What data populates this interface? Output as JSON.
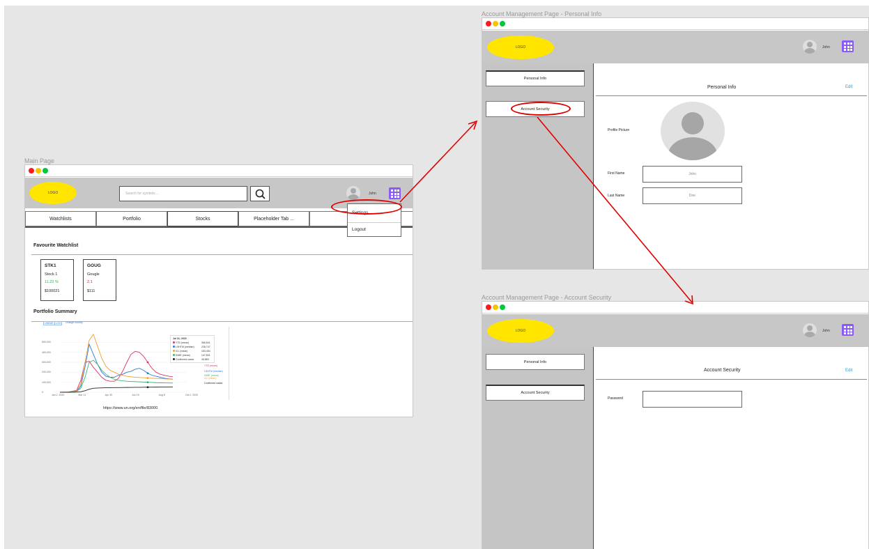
{
  "main_page": {
    "frame_label": "Main Page",
    "logo": "LOGO",
    "search_placeholder": "Search for symbols ...",
    "username": "John",
    "tabs": [
      "Watchlists",
      "Portfolio",
      "Stocks",
      "Placeholder Tab ..."
    ],
    "menu": {
      "settings": "Settings",
      "logout": "Logout"
    },
    "watchlist_title": "Favourite Watchlist",
    "cards": [
      {
        "symbol": "STK1",
        "name": "Stock 1",
        "change": "11.23 %",
        "change_color": "#2bb24c",
        "price": "$100021"
      },
      {
        "symbol": "GOUG",
        "name": "Gougle",
        "change": "2.1",
        "change_color": "#e02020",
        "price": "$111"
      }
    ],
    "portfolio_title": "Portfolio Summary",
    "chart_caption": "https://www.un.org/en/file/83000"
  },
  "personal_page": {
    "frame_label": "Account Management Page - Personal Info",
    "logo": "LOGO",
    "username": "John",
    "sidebar": [
      "Personal Info",
      "Account Security"
    ],
    "panel_title": "Personal Info",
    "edit": "Edit",
    "profile_label": "Profile Picture",
    "first_name_label": "First Name",
    "first_name_value": "John",
    "last_name_label": "Last Name",
    "last_name_value": "Doe"
  },
  "security_page": {
    "frame_label": "Account Management Page - Account Security",
    "logo": "LOGO",
    "username": "John",
    "sidebar": [
      "Personal Info",
      "Account Security"
    ],
    "panel_title": "Account Security",
    "edit": "Edit",
    "password_label": "Password"
  },
  "colors": {
    "logo": "#ffe500",
    "grid_icon": "#8a5cf5",
    "annotation": "#e00000",
    "edit_link": "#1aa0e8"
  },
  "chart_data": {
    "type": "line",
    "x_ticks": [
      "Jan 2, 2020",
      "Mar 11",
      "Apr 30",
      "Jun 19",
      "Aug 8",
      "Oct 2, 2020"
    ],
    "y_ticks": [
      "0",
      "100,000",
      "200,000",
      "300,000",
      "400,000",
      "500,000"
    ],
    "ylim": [
      0,
      600000
    ],
    "x": [
      0,
      20,
      40,
      50,
      60,
      70,
      80,
      90,
      100,
      110,
      120,
      130,
      140,
      150,
      160,
      170,
      180,
      190,
      200,
      210,
      220,
      230,
      240,
      250,
      260,
      270
    ],
    "series": [
      {
        "name": "YTD (mean)",
        "color": "#e0306a",
        "values": [
          0,
          2000,
          20000,
          120000,
          300000,
          310000,
          250000,
          200000,
          150000,
          120000,
          110000,
          110000,
          140000,
          210000,
          300000,
          380000,
          410000,
          400000,
          360000,
          300000,
          240000,
          200000,
          180000,
          170000,
          160000,
          155000
        ]
      },
      {
        "name": "LSHTM (median)",
        "color": "#2a7bd6",
        "values": [
          0,
          1000,
          10000,
          60000,
          250000,
          480000,
          380000,
          280000,
          200000,
          160000,
          150000,
          150000,
          170000,
          180000,
          200000,
          210000,
          230000,
          240000,
          220000,
          190000,
          170000,
          160000,
          150000,
          140000,
          135000,
          130000
        ]
      },
      {
        "name": "ICL (mean)",
        "color": "#f0a030",
        "values": [
          0,
          1000,
          15000,
          80000,
          300000,
          520000,
          580000,
          460000,
          340000,
          260000,
          220000,
          200000,
          180000,
          170000,
          160000,
          155000,
          150000,
          148000,
          145000,
          142000,
          140000,
          138000,
          136000,
          134000,
          132000,
          130000
        ]
      },
      {
        "name": "IHME (mean)",
        "color": "#3cb371",
        "values": [
          0,
          500,
          8000,
          40000,
          150000,
          300000,
          320000,
          280000,
          220000,
          180000,
          150000,
          130000,
          120000,
          115000,
          110000,
          108000,
          106000,
          104000,
          102000,
          100000,
          98000,
          96000,
          95000,
          94000,
          93000,
          92000
        ]
      },
      {
        "name": "Confirmed cases",
        "color": "#222222",
        "values": [
          0,
          0,
          1000,
          5000,
          15000,
          30000,
          40000,
          42000,
          44000,
          45000,
          46000,
          46500,
          47000,
          47500,
          48000,
          48500,
          49000,
          49500,
          50000,
          50500,
          51000,
          51500,
          52000,
          52500,
          53000,
          53500
        ]
      }
    ],
    "legend": {
      "date": "Jul 31, 2020",
      "rows": [
        {
          "label": "YTD (mean)",
          "value": "366,841"
        },
        {
          "label": "LSHTM (median)",
          "value": "228,747"
        },
        {
          "label": "ICL (mean)",
          "value": "163,454"
        },
        {
          "label": "IHME (mean)",
          "value": "147,801"
        },
        {
          "label": "Confirmed cases",
          "value": "45,863"
        }
      ]
    },
    "end_labels": [
      "YTD (mean)",
      "LSHTM (median)",
      "IHME (mean)",
      "ICL (mean)",
      "Confirmed cases"
    ],
    "controls": [
      "LINEAR",
      "LOG",
      "Change country"
    ]
  }
}
